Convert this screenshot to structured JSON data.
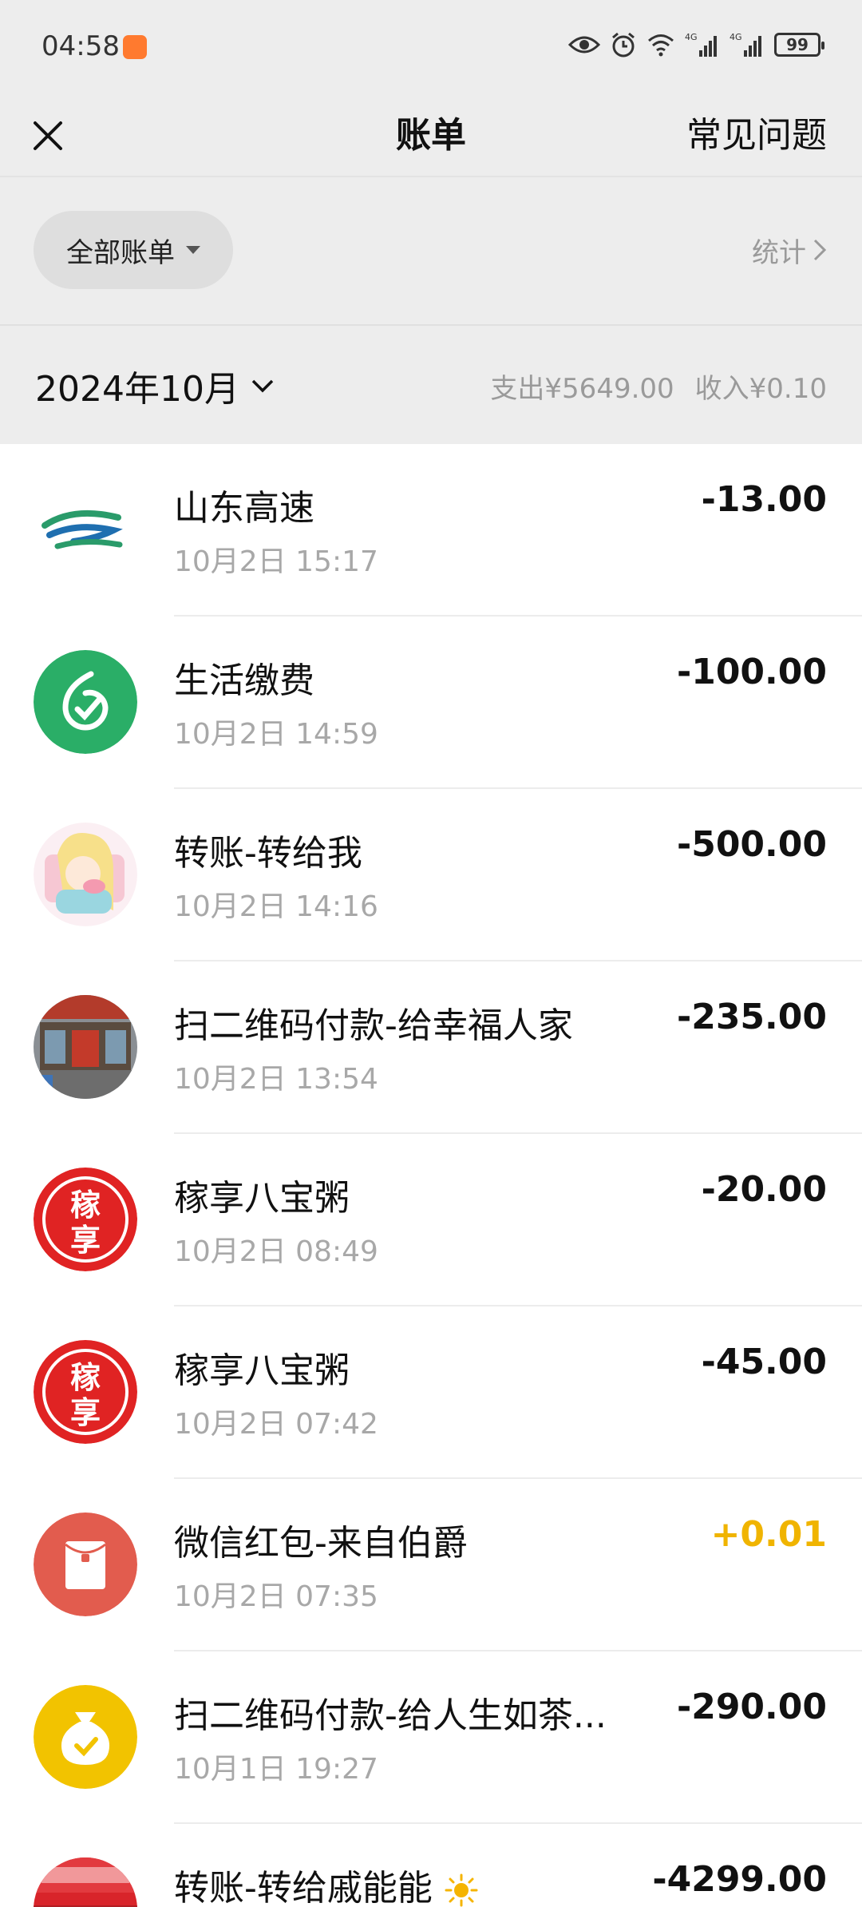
{
  "status_bar": {
    "time": "04:58",
    "signal_label_1": "4G",
    "signal_label_2": "4G",
    "battery": "99"
  },
  "nav": {
    "title": "账单",
    "faq": "常见问题"
  },
  "filter": {
    "label": "全部账单",
    "stats": "统计"
  },
  "month": {
    "label": "2024年10月",
    "expense": "支出¥5649.00",
    "income": "收入¥0.10"
  },
  "transactions": [
    {
      "title": "山东高速",
      "time": "10月2日 15:17",
      "amount": "-13.00",
      "avatar": "highway-logo"
    },
    {
      "title": "生活缴费",
      "time": "10月2日 14:59",
      "amount": "-100.00",
      "avatar": "utility-payment-logo"
    },
    {
      "title": "转账-转给我",
      "time": "10月2日 14:16",
      "amount": "-500.00",
      "avatar": "cartoon-avatar"
    },
    {
      "title": "扫二维码付款-给幸福人家",
      "time": "10月2日 13:54",
      "amount": "-235.00",
      "avatar": "storefront-photo"
    },
    {
      "title": "稼享八宝粥",
      "time": "10月2日 08:49",
      "amount": "-20.00",
      "avatar": "jiaxiang-logo",
      "logo_text_1": "稼",
      "logo_text_2": "享"
    },
    {
      "title": "稼享八宝粥",
      "time": "10月2日 07:42",
      "amount": "-45.00",
      "avatar": "jiaxiang-logo",
      "logo_text_1": "稼",
      "logo_text_2": "享"
    },
    {
      "title": "微信红包-来自伯爵",
      "time": "10月2日 07:35",
      "amount": "+0.01",
      "avatar": "red-packet-icon"
    },
    {
      "title": "扫二维码付款-给人生如茶...",
      "time": "10月1日 19:27",
      "amount": "-290.00",
      "avatar": "money-bag-icon"
    },
    {
      "title": "转账-转给戚能能",
      "time": "",
      "amount": "-4299.00",
      "avatar": "shop-sign-photo"
    }
  ],
  "colors": {
    "background_header": "#ededed",
    "income_amount": "#f0b400",
    "utility_green": "#2aae67",
    "jiaxiang_red": "#e02323",
    "red_packet": "#e25c4e",
    "money_bag_yellow": "#f2c300"
  }
}
